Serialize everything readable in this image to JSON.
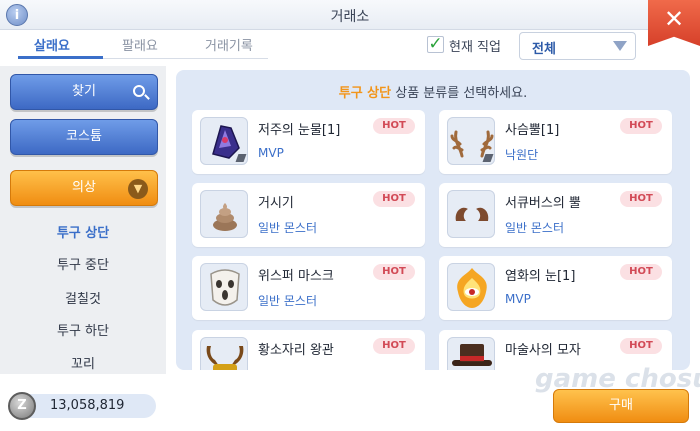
{
  "window": {
    "title": "거래소",
    "info_icon": "info-icon",
    "close_icon": "close-x-icon"
  },
  "tabs": [
    {
      "label": "살래요",
      "active": true
    },
    {
      "label": "팔래요",
      "active": false
    },
    {
      "label": "거래기록",
      "active": false
    }
  ],
  "job_filter": {
    "checked": true,
    "label": "현재 직업"
  },
  "dropdown": {
    "value": "전체"
  },
  "sidebar": {
    "search_label": "찾기",
    "costume_label": "코스튬",
    "clothing_label": "의상",
    "sub_items": [
      {
        "label": "투구 상단",
        "active": true
      },
      {
        "label": "투구 중단",
        "active": false
      },
      {
        "label": "걸칠것",
        "active": false
      },
      {
        "label": "투구 하단",
        "active": false
      },
      {
        "label": "꼬리",
        "active": false
      }
    ]
  },
  "content": {
    "prompt_highlight": "투구 상단",
    "prompt_rest": " 상품 분류를 선택하세요.",
    "items": [
      {
        "name": "저주의 눈물[1]",
        "type": "MVP",
        "badge": "HOT",
        "icon": "cursed-tear-icon"
      },
      {
        "name": "사슴뿔[1]",
        "type": "낙원단",
        "badge": "HOT",
        "icon": "deer-antler-icon"
      },
      {
        "name": "거시기",
        "type": "일반 몬스터",
        "badge": "HOT",
        "icon": "poop-icon"
      },
      {
        "name": "서큐버스의 뿔",
        "type": "일반 몬스터",
        "badge": "HOT",
        "icon": "succubus-horn-icon"
      },
      {
        "name": "위스퍼 마스크",
        "type": "일반 몬스터",
        "badge": "HOT",
        "icon": "whisper-mask-icon"
      },
      {
        "name": "염화의 눈[1]",
        "type": "MVP",
        "badge": "HOT",
        "icon": "flame-eye-icon"
      },
      {
        "name": "황소자리 왕관",
        "type": "",
        "badge": "HOT",
        "icon": "taurus-crown-icon"
      },
      {
        "name": "마술사의 모자",
        "type": "",
        "badge": "HOT",
        "icon": "magician-hat-icon"
      }
    ]
  },
  "footer": {
    "zeny_value": "13,058,819",
    "zeny_icon_glyph": "Z",
    "buy_label": "구매",
    "watermark": "game chosun"
  }
}
